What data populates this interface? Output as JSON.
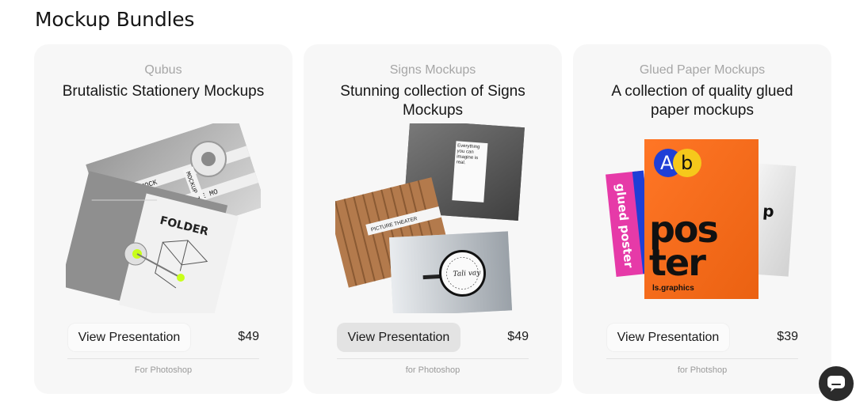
{
  "section": {
    "title": "Mockup Bundles"
  },
  "cards": [
    {
      "brand": "Qubus",
      "title": "Brutalistic Stationery Mockups",
      "button_label": "View Presentation",
      "price": "$49",
      "footnote": "For Photoshop",
      "art": {
        "tape_text_1": "MOCKUP TAPE MO",
        "tape_text_2": "TAPE MOCK",
        "tape_text_3": "TAPE MO",
        "folder_text": "FOLDER"
      }
    },
    {
      "brand": "Signs Mockups",
      "title": "Stunning collection of Signs Mockups",
      "button_label": "View Presentation",
      "price": "$49",
      "footnote": "for Photoshop",
      "art": {
        "note_text": "Everything you can imagine is real.",
        "theater_text": "PICTURE THEATER",
        "round_sign_text": "Tali vay"
      }
    },
    {
      "brand": "Glued Paper Mockups",
      "title": "A collection of quality glued paper mockups",
      "button_label": "View Presentation",
      "price": "$39",
      "footnote": "for Photshop",
      "art": {
        "badge_a": "A",
        "badge_b": "b",
        "poster_line1": "pos",
        "poster_line2": "ter",
        "brand_tag": "ls.graphics",
        "side_text": "glued poster",
        "back_text": "p",
        "accent_orange": "#ff6a13",
        "accent_pink": "#e63aa8",
        "accent_blue": "#1f3fd6",
        "accent_yellow": "#f6c81b"
      }
    }
  ],
  "chat": {
    "icon": "chat-bubble-icon"
  }
}
